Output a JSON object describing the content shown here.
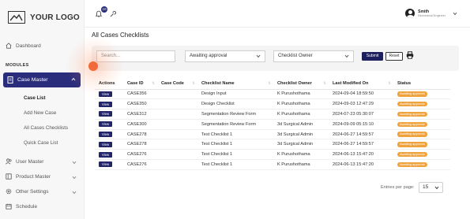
{
  "logo": {
    "text": "YOUR LOGO"
  },
  "sidebar": {
    "dashboard": "Dashboard",
    "section": "MODULES",
    "case_master": "Case Master",
    "sub_items": [
      "Case List",
      "Add New Case",
      "All Cases Checklists",
      "Quick Case List"
    ],
    "user_master": "User Master",
    "product_master": "Product Master",
    "other_settings": "Other Settings",
    "schedule": "Schedule"
  },
  "topbar": {
    "notification_count": "10",
    "user_name": "Smith",
    "user_role": "Biomedical Engineer"
  },
  "page": {
    "title": "All Cases Checklists"
  },
  "filters": {
    "search_placeholder": "Search...",
    "status_value": "Awaiting approval",
    "owner_value": "Checklist Owner",
    "submit_label": "Submit",
    "reset_label": "Reset"
  },
  "table": {
    "headers": [
      "Actions",
      "Case ID",
      "Case Code",
      "Checklist Name",
      "Checklist Owner",
      "Last Modified On",
      "Status"
    ],
    "view_label": "View",
    "rows": [
      {
        "case_id": "CASE356",
        "case_code": "",
        "name": "Design Input",
        "owner": "K Purushothama",
        "modified": "2024-09-04 18:59:50",
        "status": "Awaiting approval"
      },
      {
        "case_id": "CASE350",
        "case_code": "",
        "name": "Design Checklist",
        "owner": "K Purushothama",
        "modified": "2024-09-03 12:47:29",
        "status": "Awaiting approval"
      },
      {
        "case_id": "CASE312",
        "case_code": "",
        "name": "Segmentation Review Form",
        "owner": "K Purushothama",
        "modified": "2024-07-23 05:30:07",
        "status": "Awaiting approval"
      },
      {
        "case_id": "CASE300",
        "case_code": "",
        "name": "Segmentation Review Form",
        "owner": "3d Surgical Admin",
        "modified": "2024-09-09 05:15:10",
        "status": "Awaiting approval"
      },
      {
        "case_id": "CASE278",
        "case_code": "",
        "name": "Test Checklist 1",
        "owner": "3d Surgical Admin",
        "modified": "2024-06-27 14:59:57",
        "status": "Awaiting approval"
      },
      {
        "case_id": "CASE278",
        "case_code": "",
        "name": "Test Checklist 1",
        "owner": "3d Surgical Admin",
        "modified": "2024-06-27 14:59:57",
        "status": "Awaiting approval"
      },
      {
        "case_id": "CASE276",
        "case_code": "",
        "name": "Test Checklist 1",
        "owner": "K Purushothama",
        "modified": "2024-06-13 15:47:20",
        "status": "Awaiting approval"
      },
      {
        "case_id": "CASE276",
        "case_code": "",
        "name": "Test Checklist 1",
        "owner": "K Purushothama",
        "modified": "2024-06-13 15:47:20",
        "status": "Awaiting approval"
      }
    ]
  },
  "pagination": {
    "label": "Entries per page:",
    "value": "15"
  },
  "colors": {
    "primary": "#2a2d7c",
    "status_orange": "#f0a23c",
    "accent_dot": "#f26a3a"
  }
}
